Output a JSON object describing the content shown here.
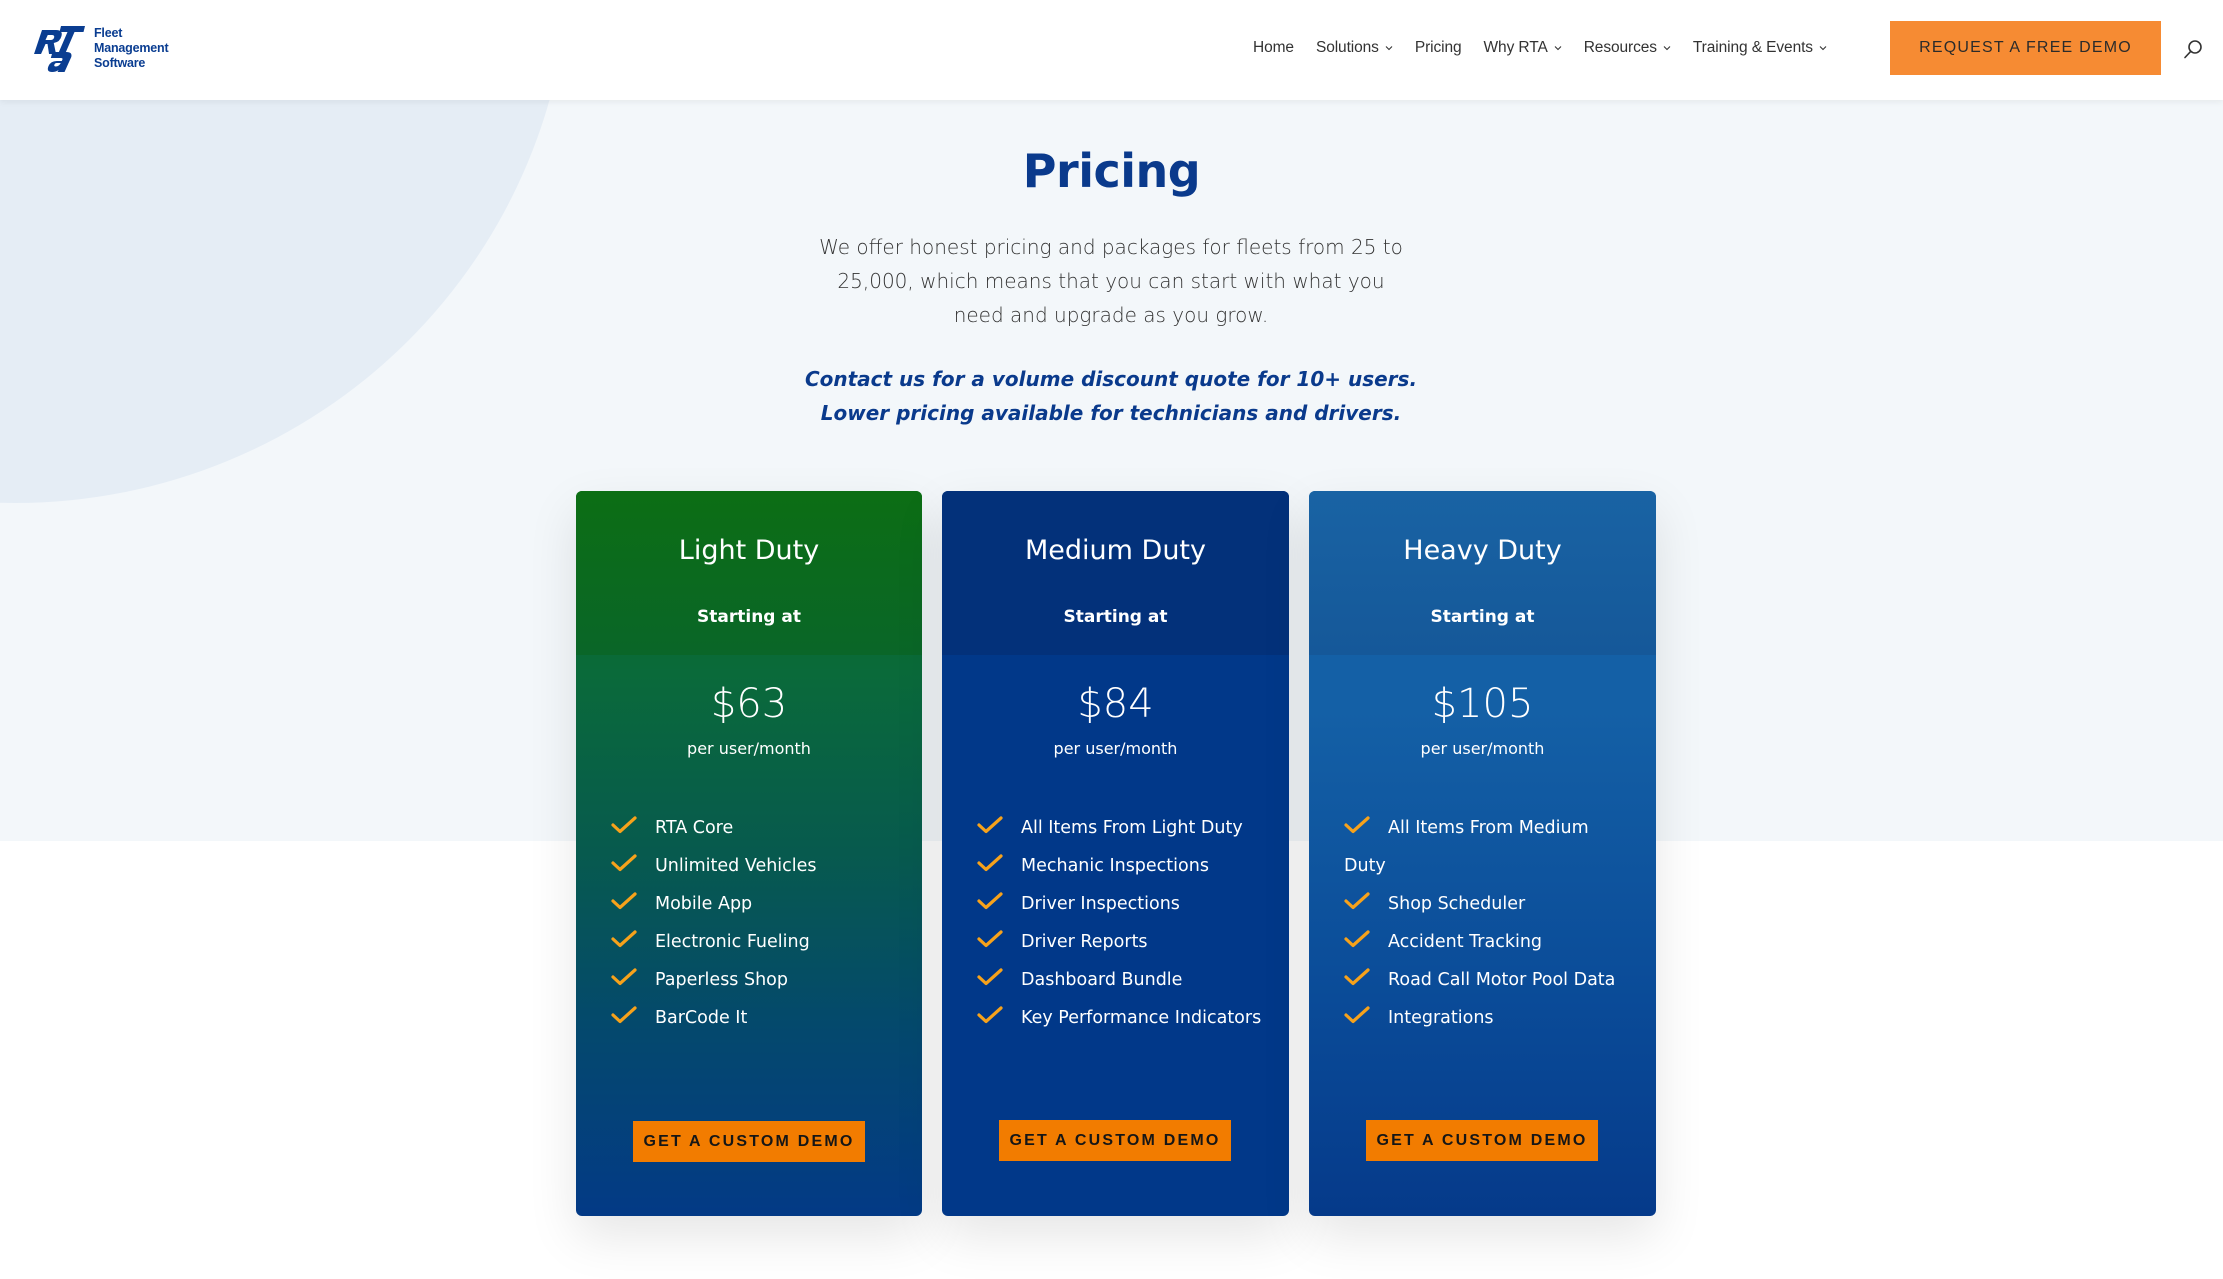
{
  "header": {
    "logo": {
      "mark": "RTA",
      "lines": [
        "Fleet",
        "Management",
        "Software"
      ]
    },
    "nav": [
      {
        "label": "Home",
        "has_dropdown": false
      },
      {
        "label": "Solutions",
        "has_dropdown": true
      },
      {
        "label": "Pricing",
        "has_dropdown": false
      },
      {
        "label": "Why RTA",
        "has_dropdown": true
      },
      {
        "label": "Resources",
        "has_dropdown": true
      },
      {
        "label": "Training & Events",
        "has_dropdown": true
      }
    ],
    "cta_label": "REQUEST A FREE DEMO",
    "search_icon": "search-icon"
  },
  "hero": {
    "title": "Pricing",
    "intro": "We offer honest pricing and packages for fleets from 25 to 25,000, which means that you can start with what you need and upgrade as you grow.",
    "note_line1": "Contact us for a volume discount quote for 10+ users.",
    "note_line2": "Lower pricing available for technicians and drivers."
  },
  "plans": [
    {
      "name": "Light Duty",
      "starting_label": "Starting at",
      "price": "$63",
      "period": "per user/month",
      "features": [
        "RTA Core",
        "Unlimited Vehicles",
        "Mobile App",
        "Electronic Fueling",
        "Paperless Shop",
        "BarCode It"
      ],
      "button_label": "GET A CUSTOM DEMO"
    },
    {
      "name": "Medium Duty",
      "starting_label": "Starting at",
      "price": "$84",
      "period": "per user/month",
      "features": [
        "All Items From Light Duty",
        "Mechanic Inspections",
        "Driver Inspections",
        "Driver Reports",
        "Dashboard Bundle",
        "Key Performance Indicators"
      ],
      "button_label": "GET A CUSTOM DEMO"
    },
    {
      "name": "Heavy Duty",
      "starting_label": "Starting at",
      "price": "$105",
      "period": "per user/month",
      "features": [
        "All Items From Medium Duty",
        "Shop Scheduler",
        "Accident Tracking",
        "Road Call Motor Pool Data",
        "Integrations"
      ],
      "button_label": "GET A CUSTOM DEMO"
    }
  ],
  "colors": {
    "brand_blue": "#0a3a8c",
    "cta_orange": "#F68B33",
    "button_orange": "#F27C00",
    "check_orange": "#F7A21B",
    "light_duty_green": "#0c6e14",
    "medium_duty_navy": "#013889",
    "heavy_duty_blue": "#1562a8",
    "hero_bg": "#F3F7FA"
  }
}
